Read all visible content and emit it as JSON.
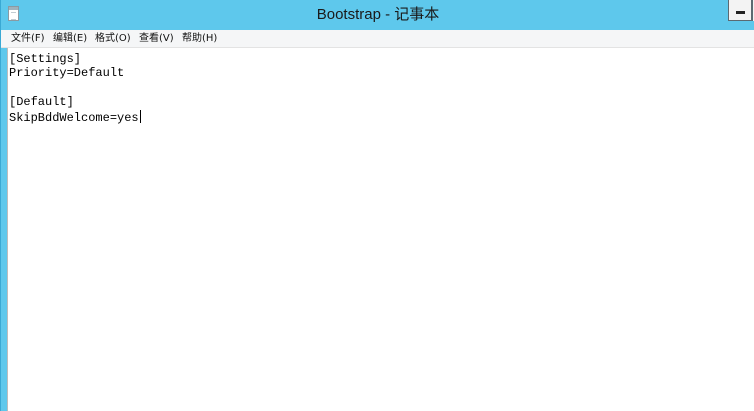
{
  "window": {
    "title": "Bootstrap - 记事本"
  },
  "menubar": {
    "items": [
      {
        "label": "文件(F)"
      },
      {
        "label": "编辑(E)"
      },
      {
        "label": "格式(O)"
      },
      {
        "label": "查看(V)"
      },
      {
        "label": "帮助(H)"
      }
    ]
  },
  "editor": {
    "lines": [
      "[Settings]",
      "Priority=Default",
      "",
      "[Default]",
      "SkipBddWelcome=yes"
    ]
  },
  "icons": {
    "app": "notepad-icon",
    "minimize": "minimize-icon"
  },
  "colors": {
    "titlebar": "#5ec8ec",
    "menubar": "#f5f6f7",
    "editor_background": "#ffffff",
    "text": "#000000"
  }
}
